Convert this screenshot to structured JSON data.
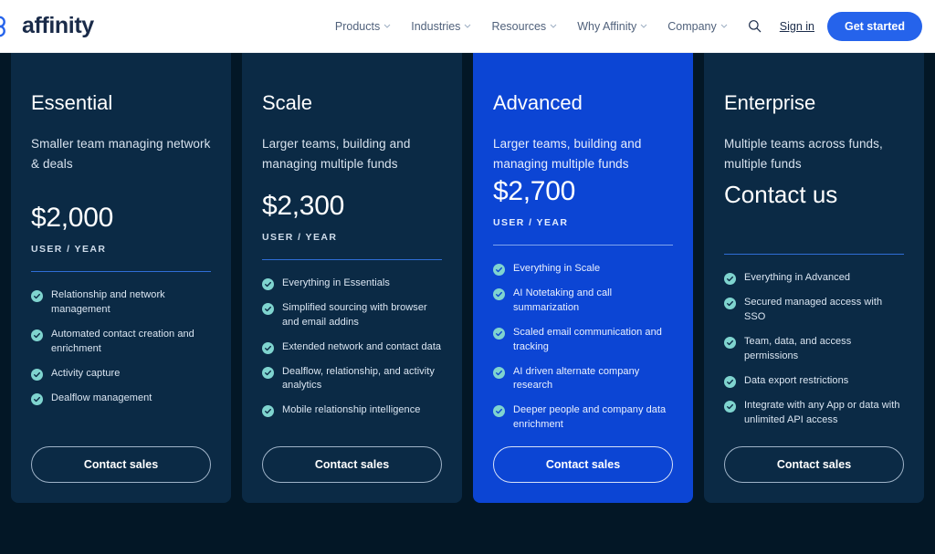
{
  "header": {
    "logo_text": "affinity",
    "logo_icon": "affinity-infinity-logo",
    "nav_items": [
      {
        "label": "Products",
        "has_caret": true
      },
      {
        "label": "Industries",
        "has_caret": true
      },
      {
        "label": "Resources",
        "has_caret": true
      },
      {
        "label": "Why Affinity",
        "has_caret": true
      },
      {
        "label": "Company",
        "has_caret": true
      }
    ],
    "search_icon": "search-icon",
    "signin_label": "Sign in",
    "cta_label": "Get started",
    "cta_color": "#2563eb"
  },
  "pricing": {
    "background": "#031726",
    "card_background": "#0b2a45",
    "featured_background": "#0c45d4",
    "check_color": "#7fd4cf",
    "divider_color": "#2f6ed6",
    "cards": [
      {
        "name": "Essential",
        "description": "Smaller team managing network & deals",
        "price": "$2,000",
        "period": "USER  /  YEAR",
        "featured": false,
        "features": [
          "Relationship and network management",
          "Automated contact creation and enrichment",
          "Activity capture",
          "Dealflow management"
        ],
        "button_label": "Contact sales"
      },
      {
        "name": "Scale",
        "description": "Larger teams, building and managing multiple funds",
        "price": "$2,300",
        "period": "USER  /  YEAR",
        "featured": false,
        "features": [
          "Everything in Essentials",
          "Simplified sourcing with browser and email addins",
          "Extended network and contact data",
          "Dealflow, relationship, and activity analytics",
          "Mobile relationship intelligence"
        ],
        "button_label": "Contact sales"
      },
      {
        "name": "Advanced",
        "description": "Larger teams, building and managing multiple funds",
        "price": "$2,700",
        "period": "USER  /  YEAR",
        "featured": true,
        "features": [
          "Everything in Scale",
          "AI Notetaking and call summarization",
          "Scaled email communication and tracking",
          "AI driven alternate company research",
          "Deeper people and company data enrichment"
        ],
        "button_label": "Contact sales"
      },
      {
        "name": "Enterprise",
        "description": "Multiple teams across funds, multiple funds",
        "price": "Contact us",
        "period": "",
        "featured": false,
        "features": [
          "Everything in Advanced",
          "Secured managed access with SSO",
          "Team, data, and access permissions",
          "Data export restrictions",
          "Integrate with any App or data with unlimited API access"
        ],
        "button_label": "Contact sales"
      }
    ]
  }
}
